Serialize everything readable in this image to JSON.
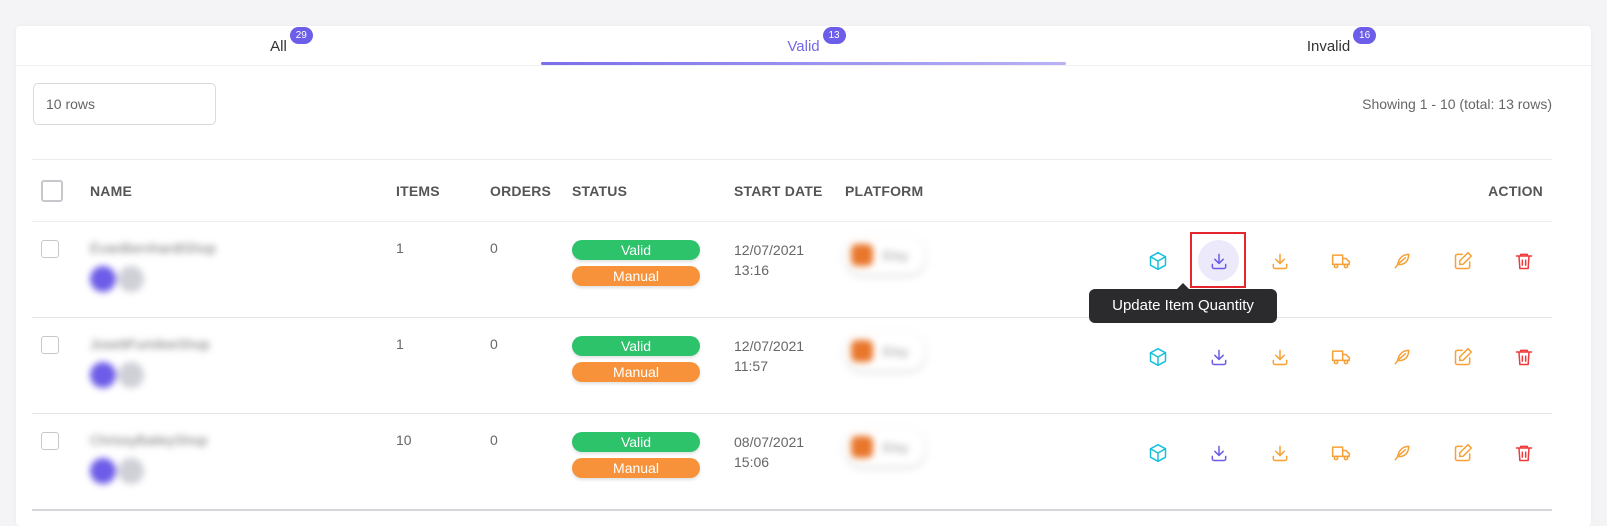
{
  "tabs": [
    {
      "label": "All",
      "count": "29",
      "active": false
    },
    {
      "label": "Valid",
      "count": "13",
      "active": true
    },
    {
      "label": "Invalid",
      "count": "16",
      "active": false
    }
  ],
  "rows_select": {
    "value": "10 rows"
  },
  "showing_text": "Showing 1 - 10 (total: 13 rows)",
  "table": {
    "headers": {
      "name": "NAME",
      "items": "ITEMS",
      "orders": "ORDERS",
      "status": "STATUS",
      "start_date": "START DATE",
      "platform": "PLATFORM",
      "action": "ACTION"
    },
    "rows": [
      {
        "name": "EvanBernhardtShop",
        "avatar1": "AD",
        "avatar2": "",
        "items": "1",
        "orders": "0",
        "status": "Valid",
        "type": "Manual",
        "date": "12/07/2021",
        "time": "13:16",
        "platform": "Etsy"
      },
      {
        "name": "JosettFumileeShop",
        "avatar1": "AD",
        "avatar2": "",
        "items": "1",
        "orders": "0",
        "status": "Valid",
        "type": "Manual",
        "date": "12/07/2021",
        "time": "11:57",
        "platform": "Etsy"
      },
      {
        "name": "ChrissyBaileyShop",
        "avatar1": "AD",
        "avatar2": "AD",
        "items": "10",
        "orders": "0",
        "status": "Valid",
        "type": "Manual",
        "date": "08/07/2021",
        "time": "15:06",
        "platform": "Etsy"
      }
    ]
  },
  "action_icons": [
    "box-icon",
    "download-icon",
    "import-icon",
    "truck-icon",
    "feather-icon",
    "edit-icon",
    "trash-icon"
  ],
  "tooltip": {
    "text": "Update Item Quantity"
  },
  "colors": {
    "accent": "#6c5ee8",
    "valid": "#2cc36b",
    "manual": "#f7923a",
    "delete": "#ee3a3a",
    "highlight": "#e6262d"
  }
}
